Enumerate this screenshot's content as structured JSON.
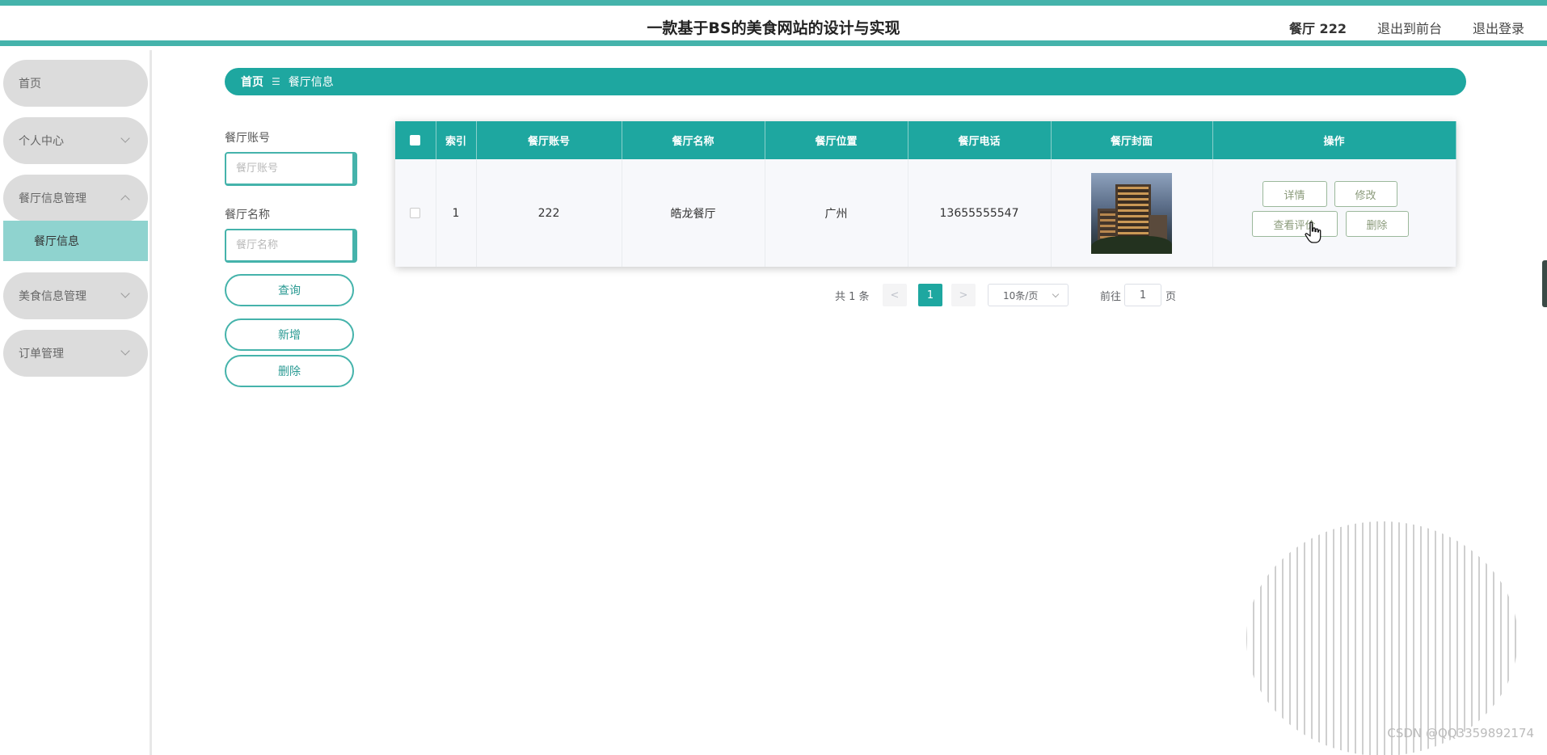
{
  "header": {
    "title": "一款基于BS的美食网站的设计与实现",
    "user": "餐厅 222",
    "front_link": "退出到前台",
    "logout": "退出登录"
  },
  "sidebar": {
    "items": [
      {
        "label": "首页"
      },
      {
        "label": "个人中心"
      },
      {
        "label": "餐厅信息管理"
      },
      {
        "label": "美食信息管理"
      },
      {
        "label": "订单管理"
      }
    ],
    "active_sub": "餐厅信息"
  },
  "breadcrumb": {
    "home": "首页",
    "separator": "☰",
    "current": "餐厅信息"
  },
  "search": {
    "account_label": "餐厅账号",
    "account_placeholder": "餐厅账号",
    "name_label": "餐厅名称",
    "name_placeholder": "餐厅名称",
    "query_btn": "查询",
    "add_btn": "新增",
    "delete_btn": "删除"
  },
  "table": {
    "columns": [
      "索引",
      "餐厅账号",
      "餐厅名称",
      "餐厅位置",
      "餐厅电话",
      "餐厅封面",
      "操作"
    ],
    "rows": [
      {
        "index": "1",
        "account": "222",
        "name": "皓龙餐厅",
        "location": "广州",
        "phone": "13655555547"
      }
    ],
    "actions": {
      "detail": "详情",
      "edit": "修改",
      "review": "查看评价",
      "delete": "删除"
    }
  },
  "pagination": {
    "total": "共 1 条",
    "prev": "<",
    "current": "1",
    "next": ">",
    "page_size": "10条/页",
    "goto_prefix": "前往",
    "goto_value": "1",
    "goto_suffix": "页"
  },
  "watermark": "CSDN @QQ3359892174",
  "colors": {
    "primary": "#1ea7a0",
    "border": "#45b3ab",
    "menu_bg": "#dcdcdc",
    "submenu_active": "#8fd3cf"
  }
}
